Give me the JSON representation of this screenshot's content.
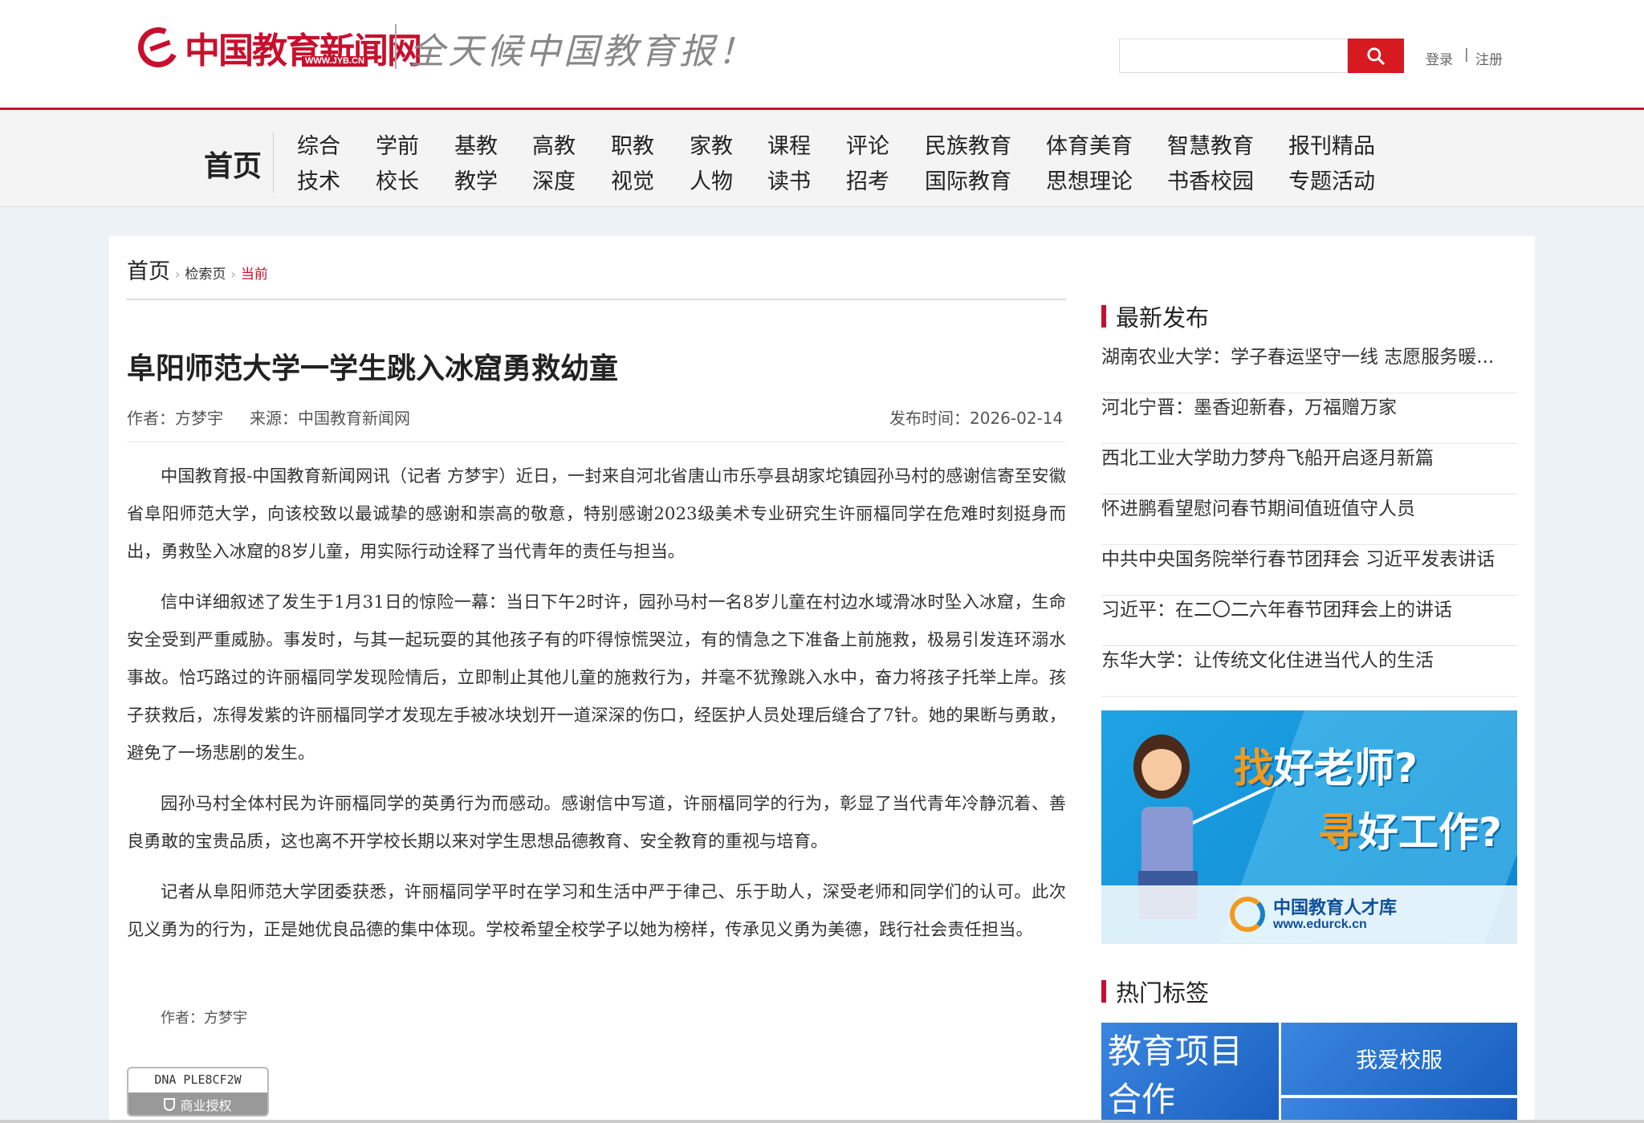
{
  "header": {
    "logo_text": "中国教育新闻网",
    "logo_url_badge": "WWW.JYB.CN",
    "slogan": "全天候中国教育报！",
    "search_placeholder": "",
    "login": "登录",
    "separator": "|",
    "register": "注册"
  },
  "nav": {
    "home": "首页",
    "row1": [
      "综合",
      "学前",
      "基教",
      "高教",
      "职教",
      "家教",
      "课程",
      "评论",
      "民族教育",
      "体育美育",
      "智慧教育",
      "报刊精品"
    ],
    "row2": [
      "技术",
      "校长",
      "教学",
      "深度",
      "视觉",
      "人物",
      "读书",
      "招考",
      "国际教育",
      "思想理论",
      "书香校园",
      "专题活动"
    ]
  },
  "breadcrumb": {
    "home": "首页",
    "search_page": "检索页",
    "current": "当前"
  },
  "article": {
    "title": "阜阳师范大学一学生跳入冰窟勇救幼童",
    "author": "作者：方梦宇",
    "source": "来源：中国教育新闻网",
    "publish_time": "发布时间：2026-02-14",
    "paragraphs": [
      "中国教育报-中国教育新闻网讯（记者 方梦宇）近日，一封来自河北省唐山市乐亭县胡家坨镇园孙马村的感谢信寄至安徽省阜阳师范大学，向该校致以最诚挚的感谢和崇高的敬意，特别感谢2023级美术专业研究生许丽楅同学在危难时刻挺身而出，勇救坠入冰窟的8岁儿童，用实际行动诠释了当代青年的责任与担当。",
      "信中详细叙述了发生于1月31日的惊险一幕：当日下午2时许，园孙马村一名8岁儿童在村边水域滑冰时坠入冰窟，生命安全受到严重威胁。事发时，与其一起玩耍的其他孩子有的吓得惊慌哭泣，有的情急之下准备上前施救，极易引发连环溺水事故。恰巧路过的许丽楅同学发现险情后，立即制止其他儿童的施救行为，并毫不犹豫跳入水中，奋力将孩子托举上岸。孩子获救后，冻得发紫的许丽楅同学才发现左手被冰块划开一道深深的伤口，经医护人员处理后缝合了7针。她的果断与勇敢，避免了一场悲剧的发生。",
      "园孙马村全体村民为许丽楅同学的英勇行为而感动。感谢信中写道，许丽楅同学的行为，彰显了当代青年冷静沉着、善良勇敢的宝贵品质，这也离不开学校长期以来对学生思想品德教育、安全教育的重视与培育。",
      "记者从阜阳师范大学团委获悉，许丽楅同学平时在学习和生活中严于律己、乐于助人，深受老师和同学们的认可。此次见义勇为的行为，正是她优良品德的集中体现。学校希望全校学子以她为榜样，传承见义勇为美德，践行社会责任担当。"
    ],
    "end_author": "作者：方梦宇",
    "dna_code": "DNA PLE8CF2W",
    "dna_label": "商业授权"
  },
  "sidebar": {
    "latest_title": "最新发布",
    "latest": [
      "湖南农业大学：学子春运坚守一线 志愿服务暖...",
      "河北宁晋：墨香迎新春，万福赠万家",
      "西北工业大学助力梦舟飞船开启逐月新篇",
      "怀进鹏看望慰问春节期间值班值守人员",
      "中共中央国务院举行春节团拜会 习近平发表讲话",
      "习近平：在二〇二六年春节团拜会上的讲话",
      "东华大学：让传统文化住进当代人的生活"
    ],
    "ad": {
      "line1_highlight": "找",
      "line1_rest": "好老师?",
      "line2_highlight": "寻",
      "line2_rest": "好工作?",
      "brand": "中国教育人才库",
      "url": "www.edurck.cn"
    },
    "tags_title": "热门标签",
    "tags": [
      "教育项目合作",
      "我爱校服"
    ]
  },
  "colors": {
    "brand_red": "#c8102e",
    "search_red": "#d71920"
  }
}
